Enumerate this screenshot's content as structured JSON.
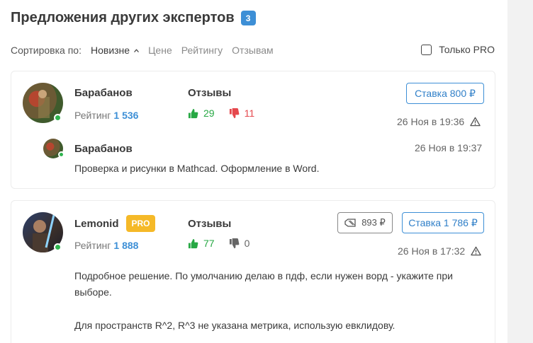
{
  "header": {
    "title": "Предложения других экспертов",
    "count": "3"
  },
  "sort": {
    "label": "Сортировка по:",
    "options": [
      "Новизне",
      "Цене",
      "Рейтингу",
      "Отзывам"
    ],
    "active": "Новизне",
    "pro_only_label": "Только PRO",
    "pro_only_checked": false
  },
  "offers": [
    {
      "name": "Барабанов",
      "rating_label": "Рейтинг",
      "rating": "1 536",
      "reviews_label": "Отзывы",
      "likes": "29",
      "dislikes": "11",
      "bid": "Ставка 800 ₽",
      "datetime": "26 Ноя в 19:36",
      "online": true,
      "reply": {
        "name": "Барабанов",
        "datetime": "26 Ноя в 19:37",
        "text": "Проверка и рисунки в Mathcad. Оформление в Word."
      }
    },
    {
      "name": "Lemonid",
      "pro": "PRO",
      "rating_label": "Рейтинг",
      "rating": "1 888",
      "reviews_label": "Отзывы",
      "likes": "77",
      "dislikes": "0",
      "prev_price": "893 ₽",
      "bid": "Ставка 1 786 ₽",
      "datetime": "26 Ноя в 17:32",
      "online": true,
      "text_p1": "Подробное решение. По умолчанию делаю в пдф, если нужен ворд - укажите при выборе.",
      "text_p2": "Для пространств R^2, R^3 не указана метрика, использую евклидову."
    }
  ],
  "colors": {
    "accent": "#3d8fd6",
    "like": "#27a844",
    "dislike": "#e5484d",
    "pro": "#f5b928",
    "online": "#2fb44f"
  },
  "icons": [
    "caret-up-icon",
    "thumbs-up-icon",
    "thumbs-down-icon",
    "warning-icon",
    "price-tag-icon"
  ]
}
